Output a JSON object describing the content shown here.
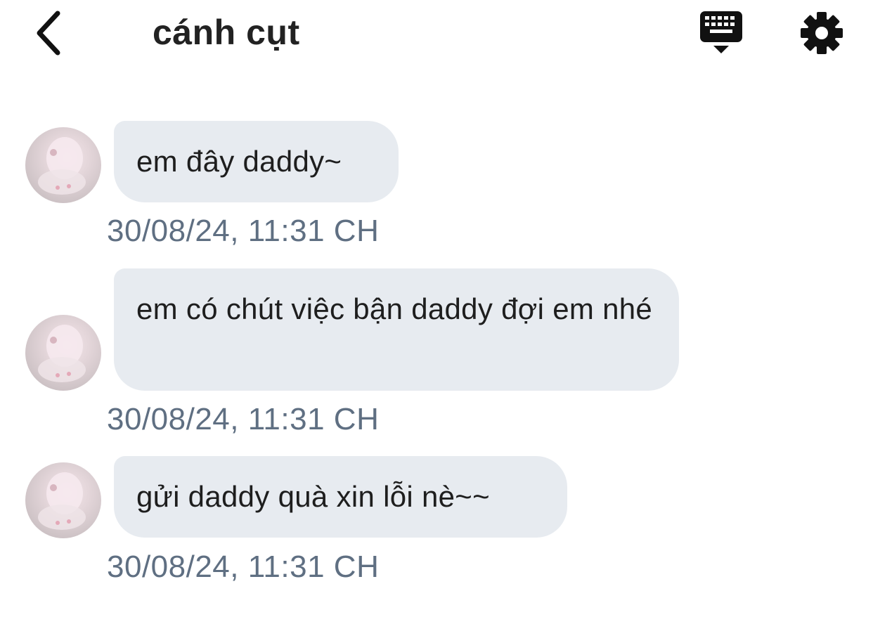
{
  "header": {
    "title": "cánh cụt",
    "back_icon": "chevron-left-icon",
    "keyboard_icon": "keyboard-icon",
    "settings_icon": "gear-icon"
  },
  "messages": [
    {
      "text": "em đây daddy~",
      "time": "30/08/24, 11:31 CH"
    },
    {
      "text": "em có chút việc bận daddy đợi em nhé",
      "time": "30/08/24, 11:31 CH"
    },
    {
      "text": "gửi daddy quà xin lỗi nè~~",
      "time": "30/08/24, 11:31 CH"
    }
  ],
  "colors": {
    "bubble": "#e7ebf0",
    "timestamp": "#5f6f82",
    "title": "#222222",
    "icon": "#111111"
  }
}
